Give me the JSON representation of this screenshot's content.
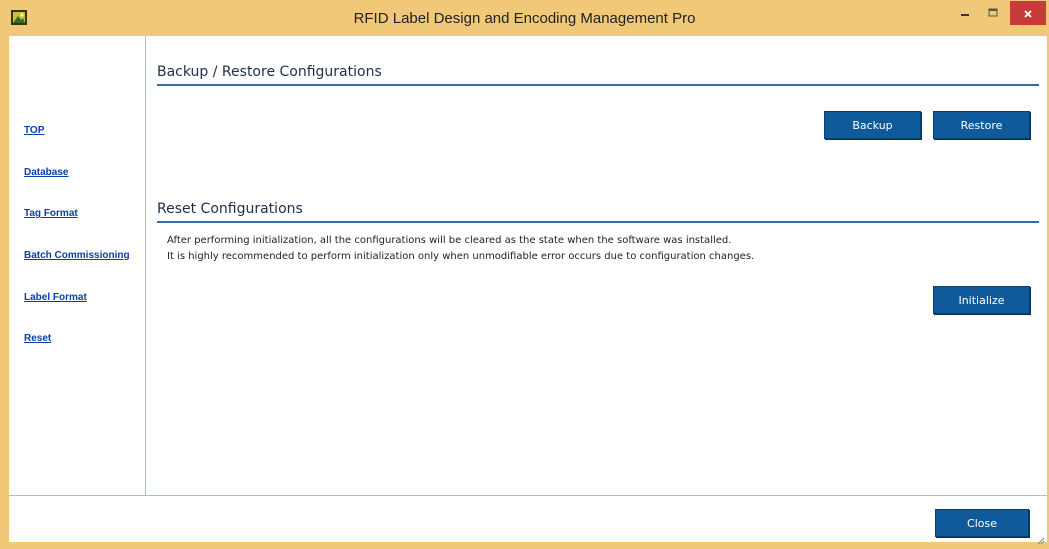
{
  "window": {
    "title": "RFID Label Design and Encoding Management Pro",
    "minimize_icon": "minimize-icon",
    "maximize_icon": "maximize-icon",
    "close_icon": "close-icon",
    "accent_color": "#f0c878",
    "close_color": "#c73a3a"
  },
  "sidebar": {
    "items": [
      {
        "label": "TOP"
      },
      {
        "label": "Database"
      },
      {
        "label": "Tag Format"
      },
      {
        "label": "Batch Commissioning"
      },
      {
        "label": "Label Format"
      },
      {
        "label": "Reset"
      }
    ],
    "link_color": "#0b3ea8"
  },
  "backup_section": {
    "title": "Backup / Restore Configurations",
    "backup_label": "Backup",
    "restore_label": "Restore"
  },
  "reset_section": {
    "title": "Reset Configurations",
    "line1": "After performing initialization, all the configurations will be cleared as the state when the software was installed.",
    "line2": "It is highly recommended to perform initialization only when unmodifiable error occurs due to configuration changes.",
    "initialize_label": "Initialize"
  },
  "footer": {
    "close_label": "Close"
  },
  "button_color": "#0f5a9a"
}
